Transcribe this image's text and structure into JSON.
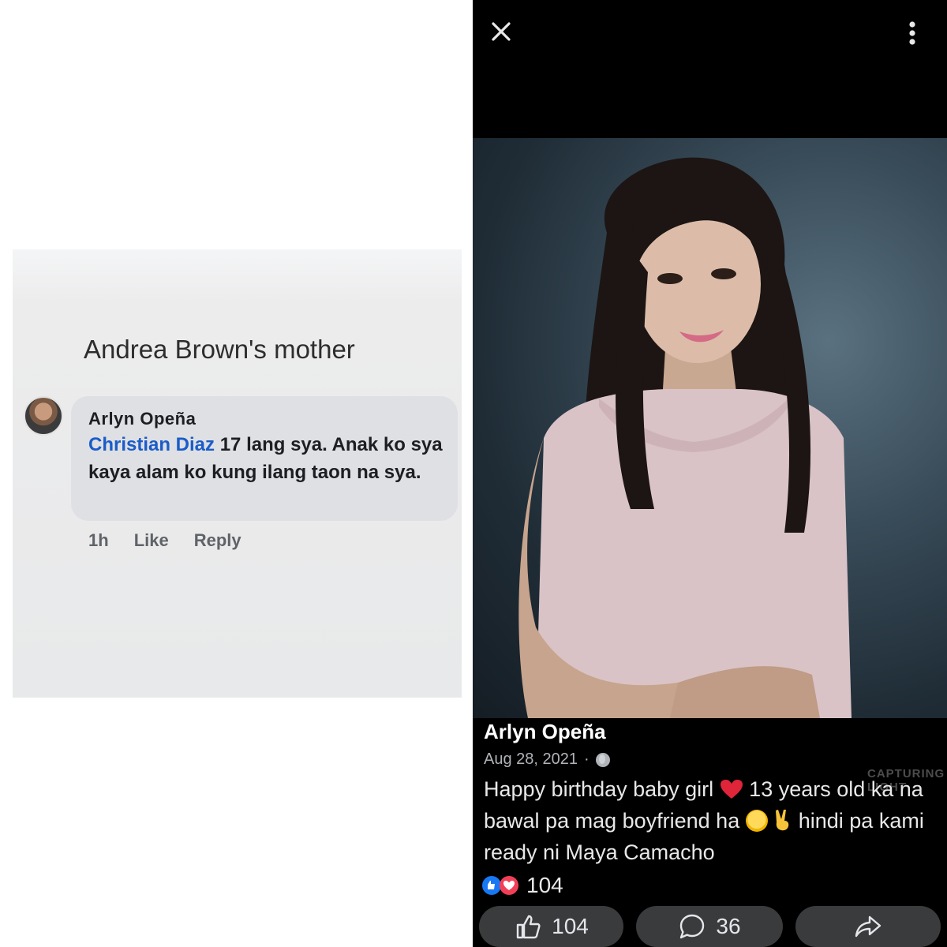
{
  "comment_panel": {
    "caption": "Andrea Brown's mother",
    "comment": {
      "author": "Arlyn  Opeña",
      "mention": "Christian Diaz",
      "text": " 17 lang sya. Anak ko sya kaya alam ko kung ilang taon na sya.",
      "time": "1h",
      "like_label": "Like",
      "reply_label": "Reply"
    }
  },
  "post_viewer": {
    "close_icon": "close-icon",
    "more_icon": "more-vertical-icon",
    "watermark": "CAPTURING LIGHT",
    "post": {
      "author": "Arlyn  Opeña",
      "date": "Aug 28, 2021",
      "separator": "·",
      "privacy_icon": "globe-icon",
      "text_part1": "Happy birthday baby girl ",
      "text_part2": " 13 years old ka na bawal pa mag boyfriend ha ",
      "text_part3": " hindi pa kami ready ni Maya Camacho"
    },
    "reactions": {
      "icons": [
        "like-reaction",
        "love-reaction"
      ],
      "count": "104"
    },
    "buttons": {
      "like_count": "104",
      "comment_count": "36"
    },
    "colors": {
      "mention": "#1a5cc9",
      "like_blue": "#1877f2",
      "love_red": "#f33e58",
      "pill_bg": "#3a3b3c"
    }
  }
}
